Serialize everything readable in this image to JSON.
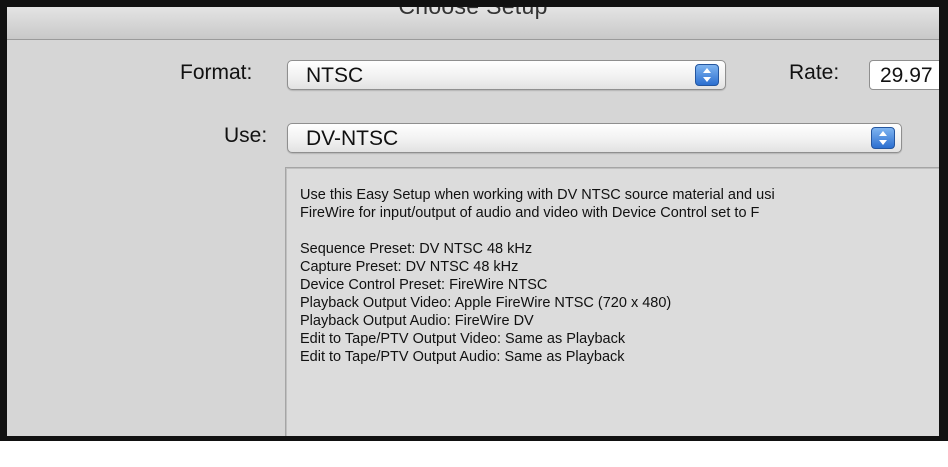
{
  "window": {
    "title": "Choose Setup"
  },
  "format": {
    "label": "Format:",
    "value": "NTSC"
  },
  "rate": {
    "label": "Rate:",
    "value": "29.97"
  },
  "use": {
    "label": "Use:",
    "value": "DV-NTSC"
  },
  "description": {
    "intro": [
      "Use this Easy Setup when working with DV NTSC source material and usi",
      "FireWire for input/output of audio and video with Device Control set to F"
    ],
    "details": [
      "Sequence Preset: DV NTSC 48 kHz",
      "Capture Preset: DV NTSC 48 kHz",
      "Device Control Preset: FireWire NTSC",
      "Playback Output Video: Apple FireWire NTSC (720 x 480)",
      "Playback Output Audio: FireWire DV",
      "Edit to Tape/PTV Output Video: Same as Playback",
      "Edit to Tape/PTV Output Audio: Same as Playback"
    ]
  },
  "icons": {
    "popup_arrows": "up-down-arrows-icon"
  },
  "colors": {
    "dialog_background": "#d6d6d6",
    "stepper_blue": "#2c6fd0",
    "border": "#111111"
  }
}
